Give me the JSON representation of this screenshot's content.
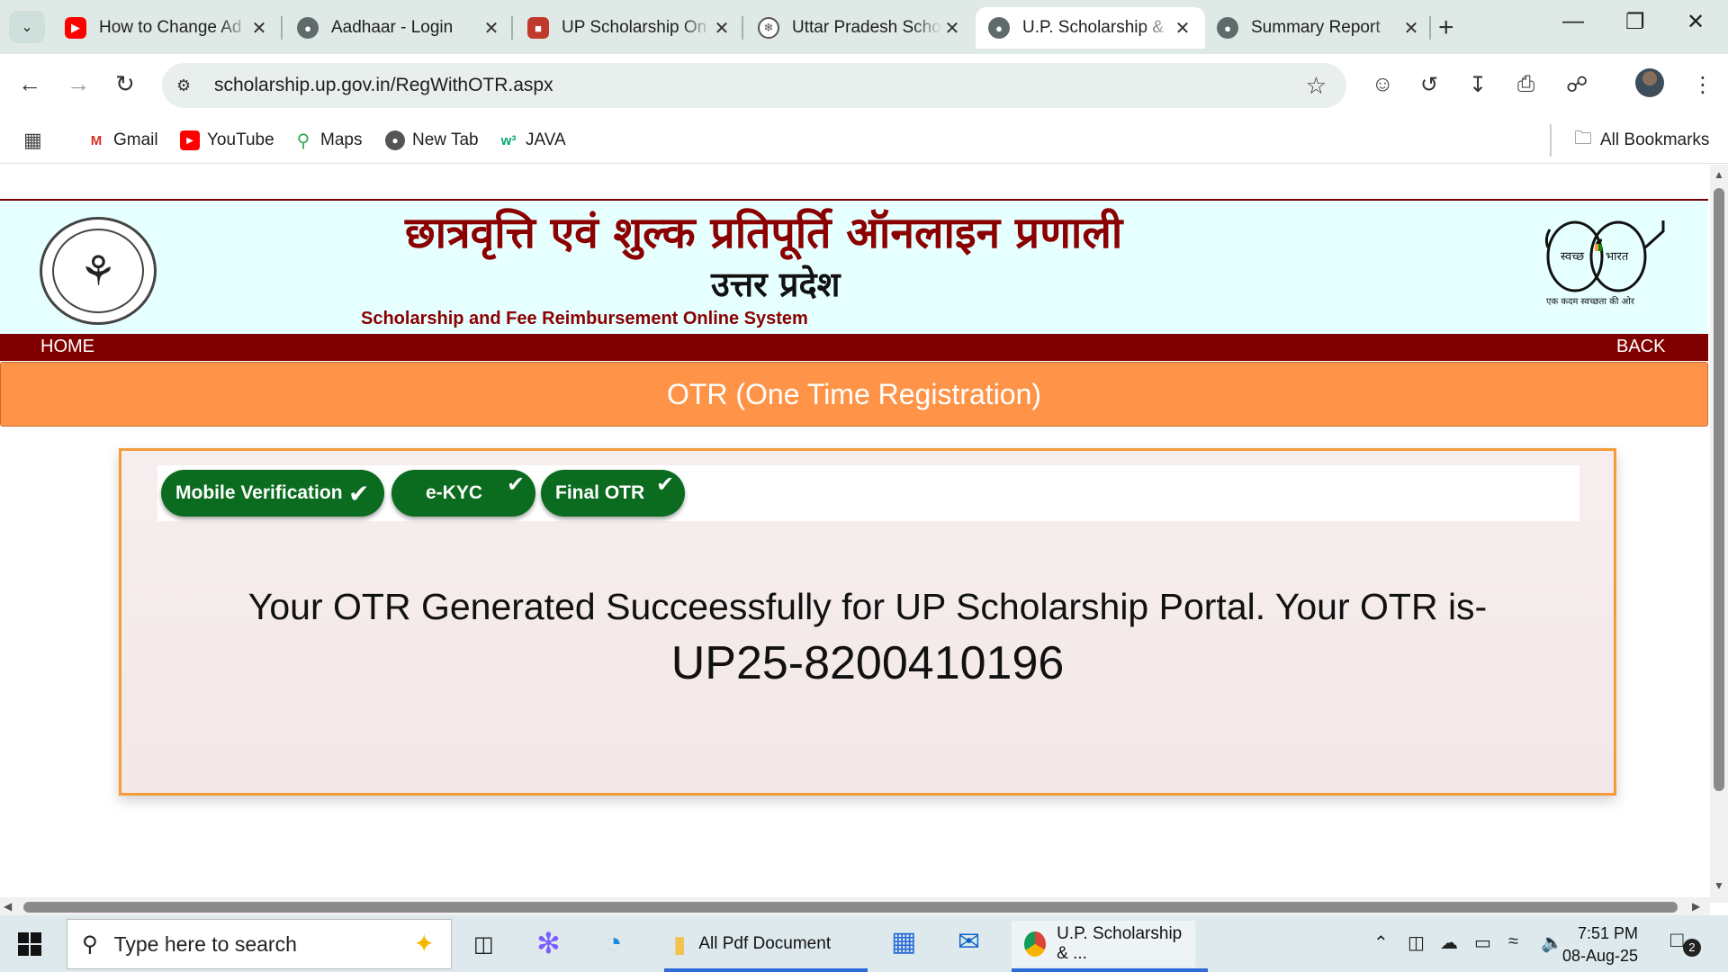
{
  "browser": {
    "tabs": [
      {
        "title": "How to Change Ad",
        "icon": "youtube-icon",
        "active": false
      },
      {
        "title": "Aadhaar - Login",
        "icon": "globe-icon",
        "active": false
      },
      {
        "title": "UP Scholarship On",
        "icon": "scholarship-icon",
        "active": false
      },
      {
        "title": "Uttar Pradesh Scho",
        "icon": "up-emblem-icon",
        "active": false
      },
      {
        "title": "U.P. Scholarship &",
        "icon": "globe-icon",
        "active": true
      },
      {
        "title": "Summary Report",
        "icon": "globe-icon",
        "active": false
      }
    ],
    "url": "scholarship.up.gov.in/RegWithOTR.aspx",
    "bookmarks": [
      {
        "label": "Gmail",
        "icon": "gmail-icon"
      },
      {
        "label": "YouTube",
        "icon": "youtube-icon"
      },
      {
        "label": "Maps",
        "icon": "maps-icon"
      },
      {
        "label": "New Tab",
        "icon": "globe-icon"
      },
      {
        "label": "JAVA",
        "icon": "w3-icon"
      }
    ],
    "all_bookmarks": "All Bookmarks"
  },
  "site": {
    "title_hindi": "छात्रवृत्ति एवं शुल्क प्रतिपूर्ति ऑनलाइन प्रणाली",
    "state_hindi": "उत्तर प्रदेश",
    "title_english": "Scholarship and Fee Reimbursement Online System",
    "logo_left": "up-government-emblem",
    "logo_right": "swachh-bharat-logo",
    "swachh_left": "स्वच्छ",
    "swachh_right": "भारत",
    "swachh_tagline": "एक कदम स्वच्छता की ओर"
  },
  "nav": {
    "home": "HOME",
    "back": "BACK"
  },
  "banner": "OTR (One Time Registration)",
  "steps": [
    {
      "label": "Mobile Verification",
      "done": true
    },
    {
      "label": "e-KYC",
      "done": true
    },
    {
      "label": "Final OTR",
      "done": true
    }
  ],
  "message": {
    "line1": "Your OTR Generated Succeessfully for UP Scholarship Portal. Your OTR is-",
    "otr_number": "UP25-8200410196"
  },
  "taskbar": {
    "search_placeholder": "Type here to search",
    "apps": [
      {
        "label": "All Pdf Document",
        "icon": "folder-icon"
      },
      {
        "label": "U.P. Scholarship & ...",
        "icon": "chrome-icon"
      }
    ],
    "time": "7:51 PM",
    "date": "08-Aug-25",
    "notification_count": "2"
  },
  "colors": {
    "header_bg": "#e6ffff",
    "maroon": "#800000",
    "banner_orange": "#ff9448",
    "step_green": "#0b6b1e",
    "panel_border": "#f59b3a"
  }
}
